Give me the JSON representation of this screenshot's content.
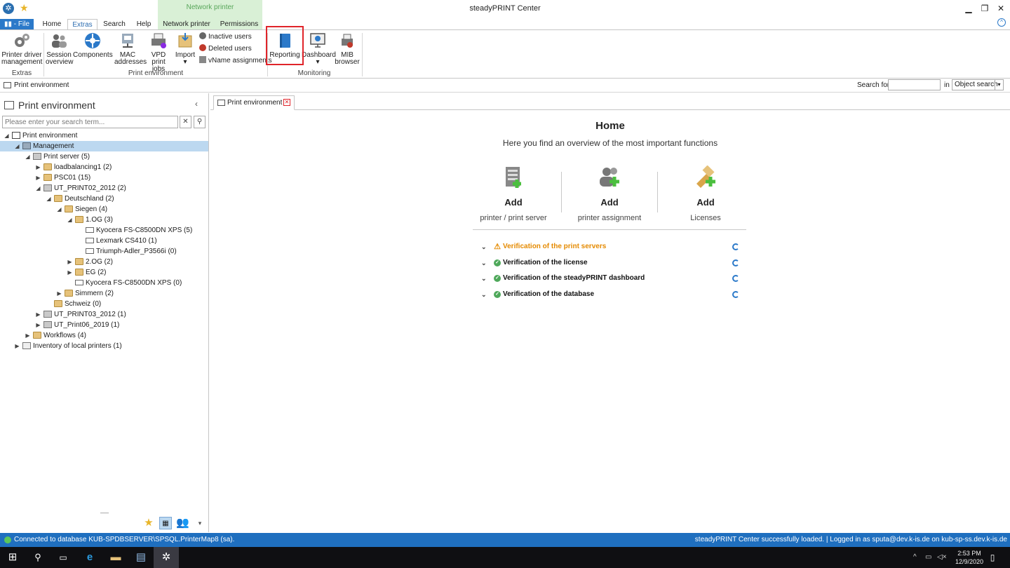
{
  "window": {
    "title": "steadyPRINT Center",
    "minimize": "▁",
    "restore": "❐",
    "close": "✕"
  },
  "ribbon_tabs": {
    "file": "File",
    "home": "Home",
    "extras": "Extras",
    "search": "Search",
    "help": "Help",
    "context_group": "Network printer",
    "network_printer": "Network printer",
    "permissions": "Permissions",
    "active": "Extras"
  },
  "ribbon": {
    "printer_driver_1": "Printer driver",
    "printer_driver_2": "management",
    "extras_group": "Extras",
    "session_1": "Session",
    "session_2": "overview",
    "components": "Components",
    "mac_1": "MAC",
    "mac_2": "addresses",
    "vpd_1": "VPD print",
    "vpd_2": "jobs",
    "import": "Import",
    "inactive_users": "Inactive users",
    "deleted_users": "Deleted users",
    "vname": "vName assignments",
    "print_env_group": "Print environment",
    "reporting": "Reporting",
    "dashboard": "Dashboard",
    "mib_1": "MIB",
    "mib_2": "browser",
    "monitoring_group": "Monitoring"
  },
  "addressbar": {
    "breadcrumb": "Print environment",
    "search_for": "Search for",
    "search_value": "",
    "in": "in",
    "scope": "Object search"
  },
  "left_panel": {
    "title": "Print environment",
    "search_placeholder": "Please enter your search term...",
    "tree": [
      {
        "label": "Print environment",
        "level": 0,
        "toggle": "◢",
        "icon": "root"
      },
      {
        "label": "Management",
        "level": 1,
        "toggle": "◢",
        "icon": "mgmt",
        "selected": true
      },
      {
        "label": "Print server (5)",
        "level": 2,
        "toggle": "◢",
        "icon": "server"
      },
      {
        "label": "loadbalancing1 (2)",
        "level": 3,
        "toggle": "▶",
        "icon": "folder"
      },
      {
        "label": "PSC01 (15)",
        "level": 3,
        "toggle": "▶",
        "icon": "folder"
      },
      {
        "label": "UT_PRINT02_2012 (2)",
        "level": 3,
        "toggle": "◢",
        "icon": "server"
      },
      {
        "label": "Deutschland (2)",
        "level": 4,
        "toggle": "◢",
        "icon": "folder"
      },
      {
        "label": "Siegen (4)",
        "level": 5,
        "toggle": "◢",
        "icon": "folder"
      },
      {
        "label": "1.OG (3)",
        "level": 6,
        "toggle": "◢",
        "icon": "folder"
      },
      {
        "label": "Kyocera FS-C8500DN XPS (5)",
        "level": 7,
        "toggle": "",
        "icon": "printer"
      },
      {
        "label": "Lexmark CS410 (1)",
        "level": 7,
        "toggle": "",
        "icon": "printer"
      },
      {
        "label": "Triumph-Adler_P3566i (0)",
        "level": 7,
        "toggle": "",
        "icon": "printer"
      },
      {
        "label": "2.OG (2)",
        "level": 6,
        "toggle": "▶",
        "icon": "folder"
      },
      {
        "label": "EG (2)",
        "level": 6,
        "toggle": "▶",
        "icon": "folder"
      },
      {
        "label": "Kyocera FS-C8500DN XPS (0)",
        "level": 6,
        "toggle": "",
        "icon": "printer"
      },
      {
        "label": "Simmern (2)",
        "level": 5,
        "toggle": "▶",
        "icon": "folder"
      },
      {
        "label": "Schweiz (0)",
        "level": 4,
        "toggle": "",
        "icon": "folder"
      },
      {
        "label": "UT_PRINT03_2012 (1)",
        "level": 3,
        "toggle": "▶",
        "icon": "server"
      },
      {
        "label": "UT_Print06_2019 (1)",
        "level": 3,
        "toggle": "▶",
        "icon": "server"
      },
      {
        "label": "Workflows (4)",
        "level": 2,
        "toggle": "▶",
        "icon": "folder"
      },
      {
        "label": "Inventory of local printers (1)",
        "level": 1,
        "toggle": "▶",
        "icon": "inv"
      }
    ]
  },
  "doc_tab": {
    "label": "Print environment"
  },
  "home": {
    "title": "Home",
    "subtitle": "Here you find an overview of the most important functions",
    "cards": [
      {
        "action": "Add",
        "label": "printer / print server"
      },
      {
        "action": "Add",
        "label": "printer assignment"
      },
      {
        "action": "Add",
        "label": "Licenses"
      }
    ],
    "verifications": [
      {
        "label": "Verification of the print servers",
        "status": "warning"
      },
      {
        "label": "Verification of the license",
        "status": "ok"
      },
      {
        "label": "Verification of the steadyPRINT dashboard",
        "status": "ok"
      },
      {
        "label": "Verification of the database",
        "status": "ok"
      }
    ]
  },
  "statusbar": {
    "left": "Connected to database KUB-SPDBSERVER\\SPSQL.PrinterMap8 (sa).",
    "right": "steadyPRINT Center successfully loaded. | Logged in as sputa@dev.k-is.de on kub-sp-ss.dev.k-is.de"
  },
  "taskbar": {
    "time": "2:53 PM",
    "date": "12/9/2020"
  },
  "colors": {
    "accent": "#2b79c9",
    "statusbar": "#1f6fbf",
    "warning": "#e58a00",
    "ok": "#4ea85a",
    "highlight_box": "#e0242a",
    "context_tab": "#d9f0d6"
  }
}
